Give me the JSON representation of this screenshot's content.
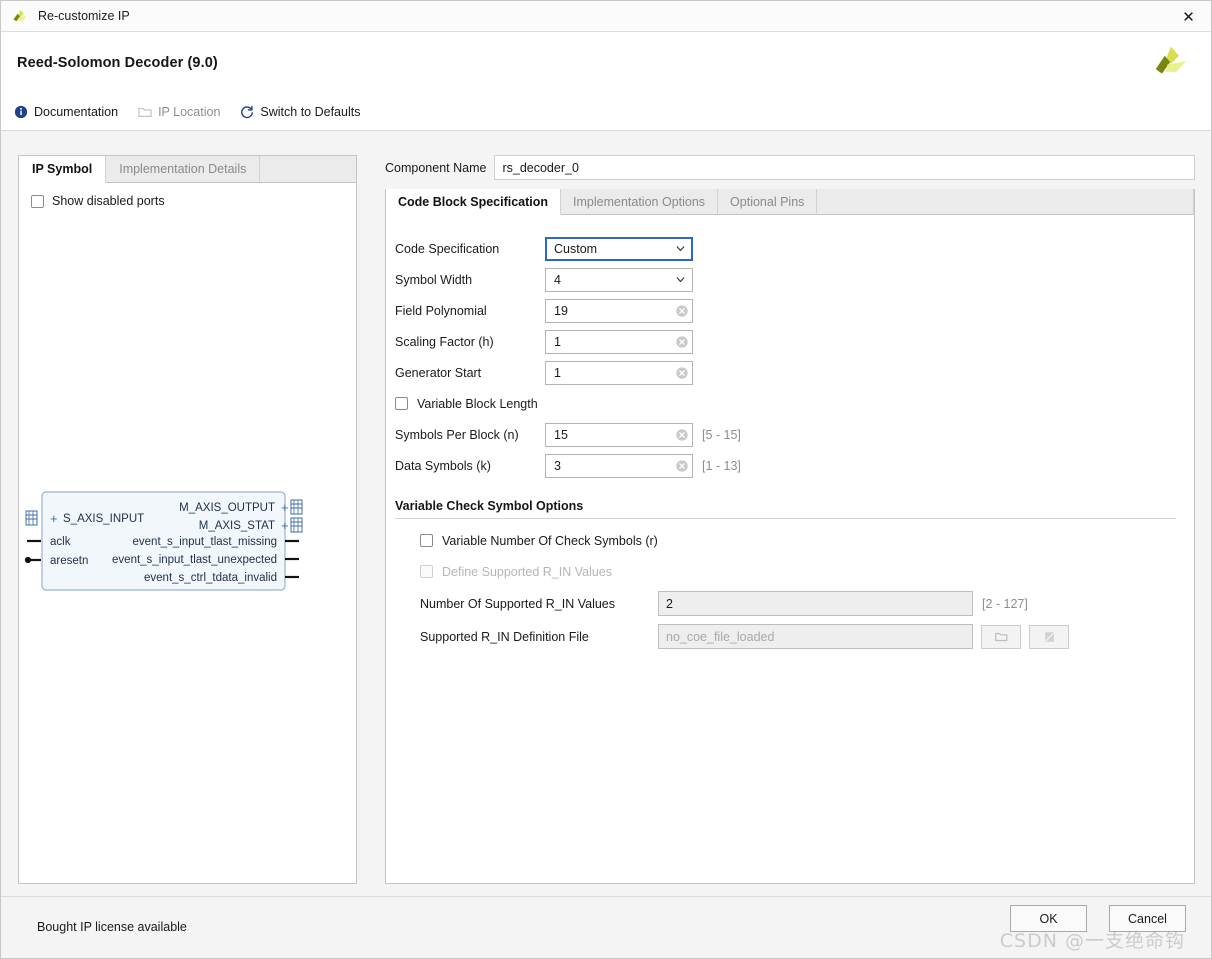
{
  "window": {
    "title": "Re-customize IP",
    "close_label": "✕",
    "logo_name": "vivado-logo"
  },
  "header": {
    "ip_title": "Reed-Solomon Decoder (9.0)",
    "brand_logo_name": "amd-xilinx-logo"
  },
  "toolbar": {
    "items": [
      {
        "label": "Documentation",
        "icon": "info-icon",
        "disabled": false
      },
      {
        "label": "IP Location",
        "icon": "folder-icon",
        "disabled": true
      },
      {
        "label": "Switch to Defaults",
        "icon": "refresh-icon",
        "disabled": false
      }
    ]
  },
  "left_pane": {
    "tabs": [
      {
        "label": "IP Symbol",
        "active": true
      },
      {
        "label": "Implementation Details",
        "active": false
      }
    ],
    "show_disabled_ports": {
      "label": "Show disabled ports",
      "checked": false
    },
    "symbol": {
      "left_ports": [
        {
          "name": "S_AXIS_INPUT",
          "type": "bus"
        },
        {
          "name": "aclk",
          "type": "clock"
        },
        {
          "name": "aresetn",
          "type": "reset_low"
        }
      ],
      "right_ports": [
        {
          "name": "M_AXIS_OUTPUT",
          "type": "bus"
        },
        {
          "name": "M_AXIS_STAT",
          "type": "bus"
        },
        {
          "name": "event_s_input_tlast_missing",
          "type": "signal"
        },
        {
          "name": "event_s_input_tlast_unexpected",
          "type": "signal"
        },
        {
          "name": "event_s_ctrl_tdata_invalid",
          "type": "signal"
        }
      ]
    }
  },
  "right_pane": {
    "component_name_label": "Component Name",
    "component_name_value": "rs_decoder_0",
    "tabs": [
      {
        "label": "Code Block Specification",
        "active": true
      },
      {
        "label": "Implementation Options",
        "active": false
      },
      {
        "label": "Optional Pins",
        "active": false
      }
    ],
    "fields": {
      "code_specification": {
        "label": "Code Specification",
        "value": "Custom"
      },
      "symbol_width": {
        "label": "Symbol Width",
        "value": "4"
      },
      "field_polynomial": {
        "label": "Field Polynomial",
        "value": "19"
      },
      "scaling_factor": {
        "label": "Scaling Factor (h)",
        "value": "1"
      },
      "generator_start": {
        "label": "Generator Start",
        "value": "1"
      },
      "variable_block_length": {
        "label": "Variable Block Length",
        "checked": false
      },
      "symbols_per_block": {
        "label": "Symbols Per Block (n)",
        "value": "15",
        "range": "[5 - 15]"
      },
      "data_symbols": {
        "label": "Data Symbols (k)",
        "value": "3",
        "range": "[1 - 13]"
      }
    },
    "variable_check_section": {
      "title": "Variable Check Symbol Options",
      "variable_number_check_symbols": {
        "label": "Variable Number Of Check Symbols (r)",
        "checked": false
      },
      "define_supported_rin": {
        "label": "Define Supported R_IN Values",
        "checked": false
      },
      "number_supported_rin": {
        "label": "Number Of Supported R_IN Values",
        "value": "2",
        "range": "[2 - 127]"
      },
      "supported_rin_file": {
        "label": "Supported R_IN Definition File",
        "placeholder": "no_coe_file_loaded",
        "browse_icon": "folder-open-icon",
        "edit_icon": "edit-file-icon"
      }
    }
  },
  "footer": {
    "license_text": "Bought IP license available",
    "ok_label": "OK",
    "cancel_label": "Cancel",
    "watermark": "CSDN @一支绝命钩"
  },
  "colors": {
    "accent_blue": "#2f66c8",
    "brand_yellow": "#c8d22d",
    "brand_olive": "#7a8410",
    "symbol_fill": "#f2f7fc",
    "symbol_border": "#9ab3d0"
  }
}
